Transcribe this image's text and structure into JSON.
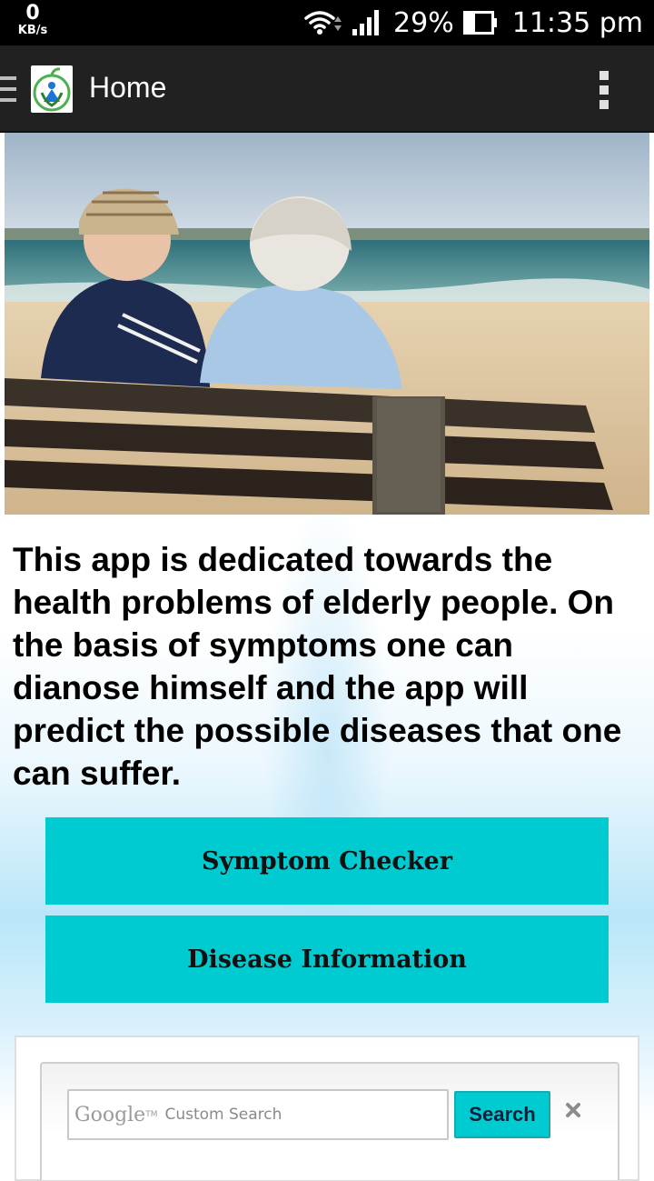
{
  "status_bar": {
    "net_speed_value": "0",
    "net_speed_unit": "KB/s",
    "battery_percent": "29%",
    "time": "11:35 pm",
    "icons": [
      "wifi-icon",
      "signal-icon",
      "battery-icon"
    ]
  },
  "action_bar": {
    "title": "Home",
    "icons": [
      "drawer-icon",
      "app-logo-icon",
      "overflow-menu-icon"
    ]
  },
  "main": {
    "description": "This app is dedicated towards the health problems of elderly people. On the basis of symptoms one can dianose himself and the app will predict the possible diseases that one can suffer.",
    "buttons": {
      "symptom_checker": "Symptom Checker",
      "disease_information": "Disease Information"
    }
  },
  "search": {
    "brand": "Google",
    "brand_tm": "TM",
    "placeholder_text": "Custom Search",
    "button_label": "Search"
  },
  "colors": {
    "accent": "#00cbd1",
    "action_bar": "#212121",
    "status_bar": "#000000"
  }
}
